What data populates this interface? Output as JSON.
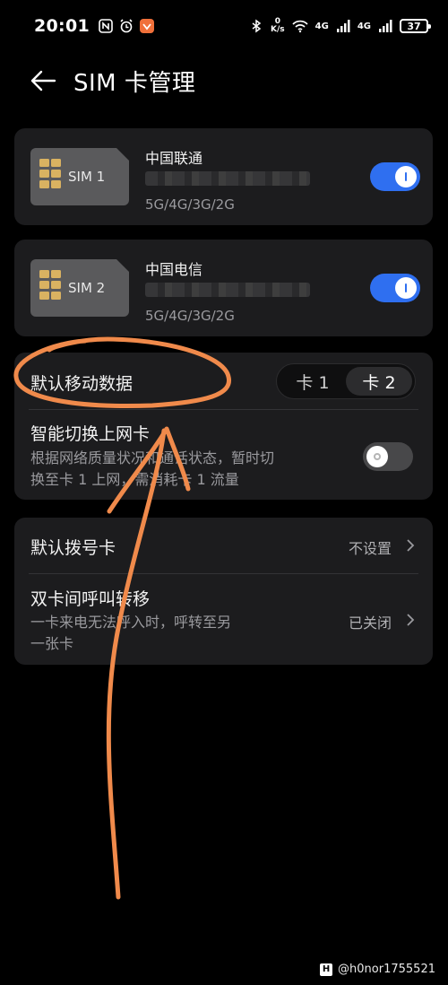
{
  "status": {
    "time": "20:01",
    "speed_value": "0",
    "speed_unit": "K/s",
    "net_type_1": "4G",
    "net_type_2": "4G",
    "battery": "37"
  },
  "header": {
    "title": "SIM 卡管理"
  },
  "sims": [
    {
      "slot_label": "SIM 1",
      "carrier": "中国联通",
      "network": "5G/4G/3G/2G",
      "enabled": true
    },
    {
      "slot_label": "SIM 2",
      "carrier": "中国电信",
      "network": "5G/4G/3G/2G",
      "enabled": true
    }
  ],
  "data_settings": {
    "default_data_label": "默认移动数据",
    "options": [
      "卡 1",
      "卡 2"
    ],
    "selected": "卡 2",
    "smart_switch_label": "智能切换上网卡",
    "smart_switch_desc_line1": "根据网络质量状况和通话状态，暂时切",
    "smart_switch_desc_line2": "换至卡 1 上网，需消耗卡 1 流量",
    "smart_switch_enabled": false
  },
  "call_settings": {
    "default_dial_label": "默认拨号卡",
    "default_dial_value": "不设置",
    "forward_label": "双卡间呼叫转移",
    "forward_desc_line1": "一卡来电无法呼入时，呼转至另",
    "forward_desc_line2": "一张卡",
    "forward_value": "已关闭"
  },
  "watermark": {
    "logo": "H",
    "handle": "@h0nor1755521"
  },
  "colors": {
    "accent": "#2f6ff0",
    "annotation": "#f08a4b",
    "card_bg": "#1c1c1e"
  }
}
